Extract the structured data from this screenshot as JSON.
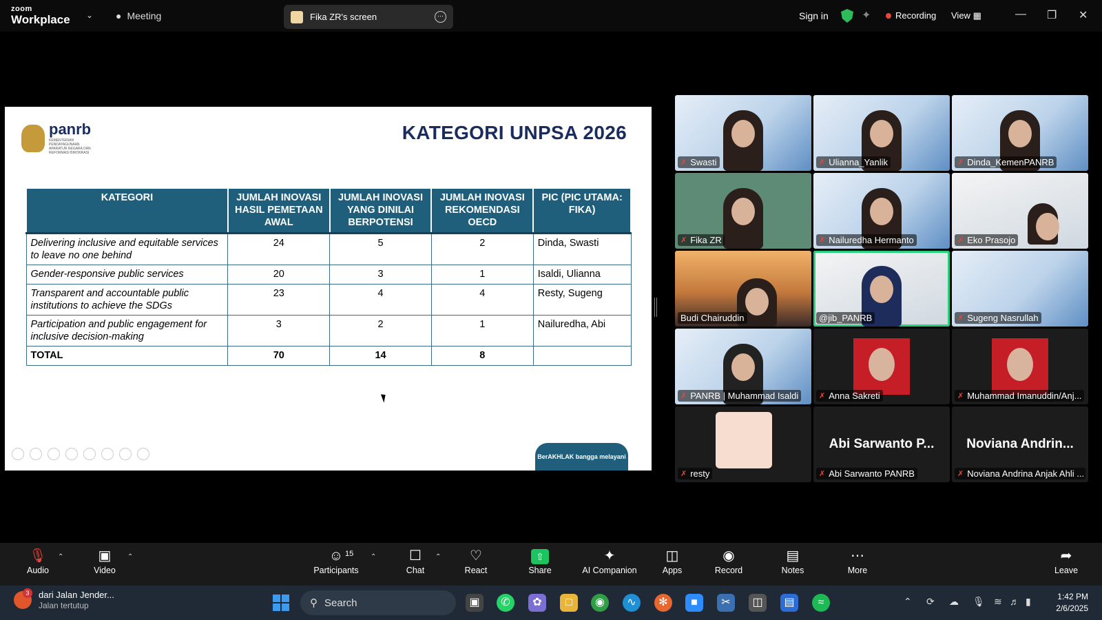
{
  "app": {
    "brand_top": "zoom",
    "brand_bottom": "Workplace"
  },
  "topbar": {
    "meeting_label": "Meeting",
    "shared_screen_label": "Fika ZR's screen",
    "sign_in": "Sign in",
    "recording": "Recording",
    "view": "View"
  },
  "slide": {
    "logo_text": "panrb",
    "logo_sub": "KEMENTERIAN PENDAYAGUNAAN APARATUR NEGARA DAN REFORMASI BIROKRASI",
    "title": "KATEGORI UNPSA 2026",
    "headers": [
      "KATEGORI",
      "JUMLAH INOVASI HASIL PEMETAAN AWAL",
      "JUMLAH INOVASI YANG DINILAI BERPOTENSI",
      "JUMLAH INOVASI REKOMENDASI OECD",
      "PIC (PIC UTAMA: FIKA)"
    ],
    "rows": [
      {
        "kategori": "Delivering inclusive and equitable services to leave no one behind",
        "pemetaan": "24",
        "potensi": "5",
        "oecd": "2",
        "pic": "Dinda, Swasti"
      },
      {
        "kategori": "Gender-responsive public services",
        "pemetaan": "20",
        "potensi": "3",
        "oecd": "1",
        "pic": "Isaldi, Ulianna"
      },
      {
        "kategori": "Transparent and accountable public institutions to achieve the SDGs",
        "pemetaan": "23",
        "potensi": "4",
        "oecd": "4",
        "pic": "Resty, Sugeng"
      },
      {
        "kategori": "Participation and public engagement for inclusive decision-making",
        "pemetaan": "3",
        "potensi": "2",
        "oecd": "1",
        "pic": "Nailuredha, Abi"
      }
    ],
    "total": {
      "label": "TOTAL",
      "pemetaan": "70",
      "potensi": "14",
      "oecd": "8",
      "pic": ""
    },
    "footer_badge": "BerAKHLAK  bangga melayani bangsa"
  },
  "participants": [
    {
      "name": "Swasti"
    },
    {
      "name": "Ulianna_Yanlik"
    },
    {
      "name": "Dinda_KemenPANRB"
    },
    {
      "name": "Fika ZR"
    },
    {
      "name": "Nailuredha Hermanto"
    },
    {
      "name": "Eko Prasojo"
    },
    {
      "name": "Budi Chairuddin"
    },
    {
      "name": "@jib_PANRB"
    },
    {
      "name": "Sugeng Nasrullah"
    },
    {
      "name": "PANRB | Muhammad Isaldi"
    },
    {
      "name": "Anna Sakreti"
    },
    {
      "name": "Muhammad Imanuddin/Anj..."
    },
    {
      "name": "resty"
    },
    {
      "name": "Abi Sarwanto PANRB",
      "big": "Abi Sarwanto P..."
    },
    {
      "name": "Noviana Andrina Anjak Ahli ...",
      "big": "Noviana  Andrin..."
    }
  ],
  "toolbar": {
    "audio": "Audio",
    "video": "Video",
    "participants": "Participants",
    "participants_count": "15",
    "chat": "Chat",
    "react": "React",
    "share": "Share",
    "ai_companion": "AI Companion",
    "apps": "Apps",
    "record": "Record",
    "notes": "Notes",
    "more": "More",
    "leave": "Leave"
  },
  "taskbar": {
    "news_badge": "3",
    "news_title": "dari Jalan Jender...",
    "news_sub": "Jalan tertutup",
    "search_placeholder": "Search",
    "time": "1:42 PM",
    "date": "2/6/2025"
  },
  "colors": {
    "header_blue": "#1f5f7c",
    "title_navy": "#1a2b5e",
    "share_green": "#1bc45f",
    "active_speaker": "#26d07c",
    "recording_red": "#e8453c"
  }
}
